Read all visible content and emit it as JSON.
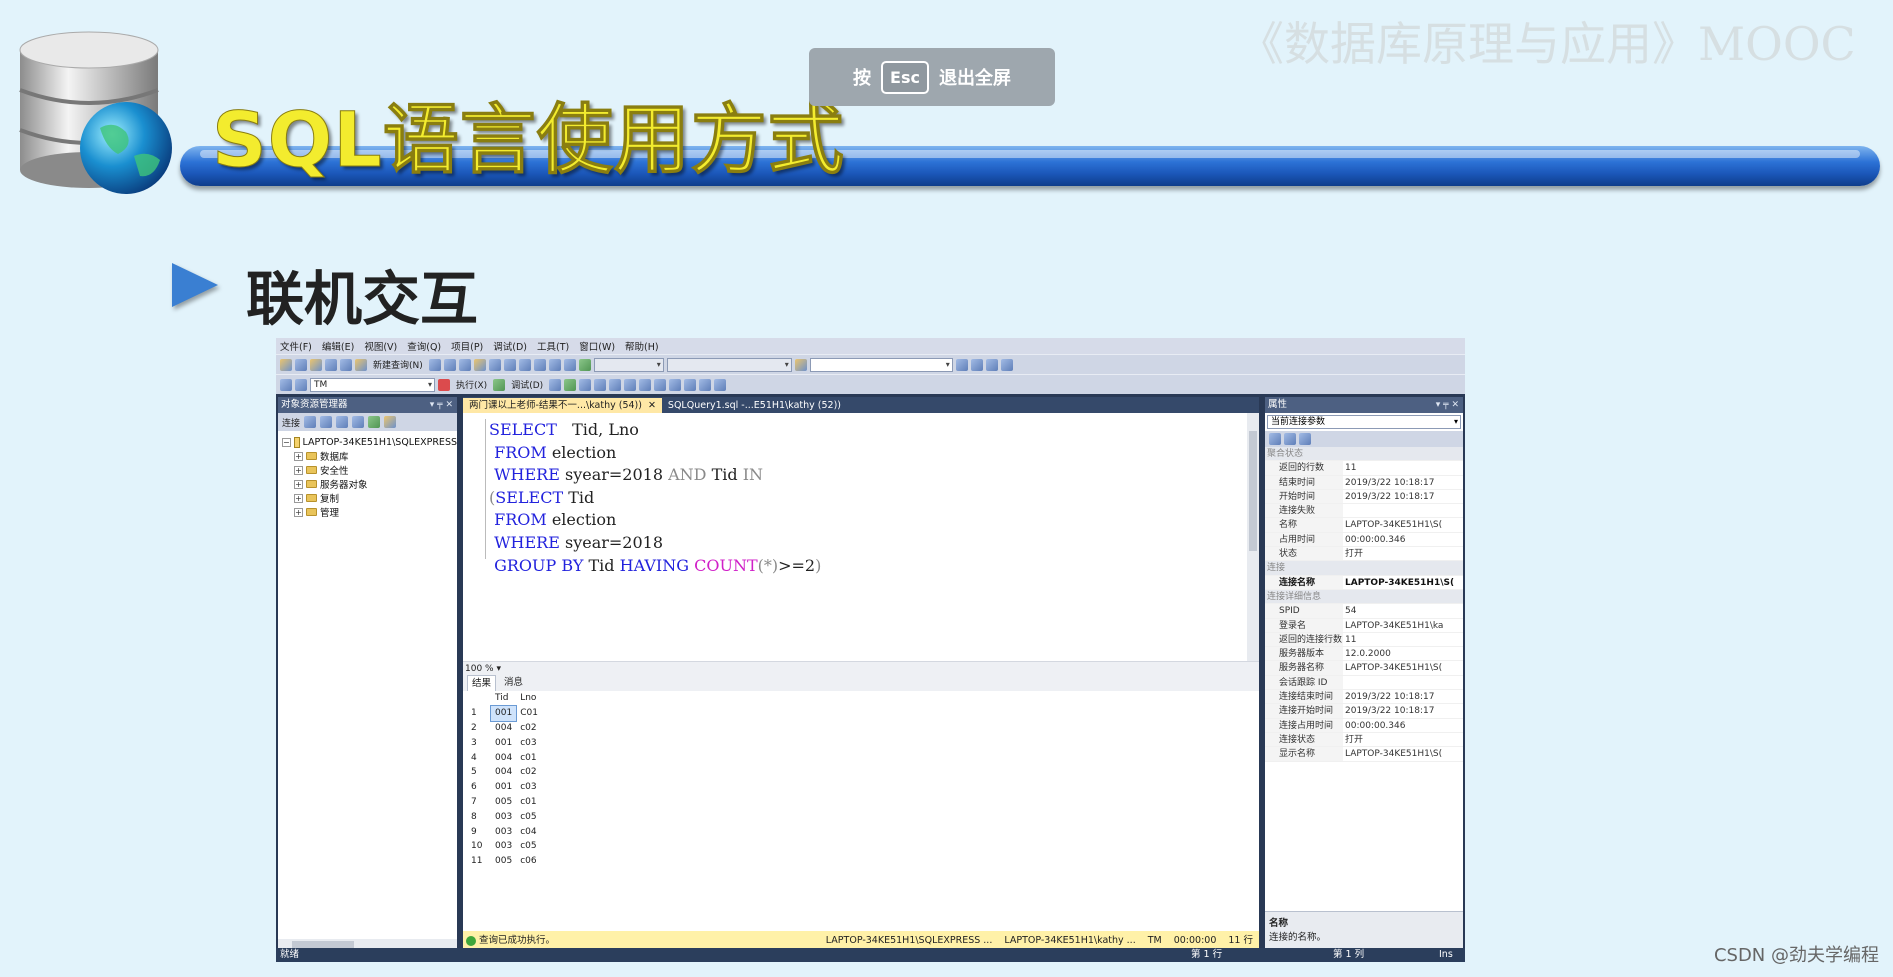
{
  "slide": {
    "title": "SQL语言使用方式",
    "course": "《数据库原理与应用》MOOC",
    "bullet": "联机交互",
    "watermark": "CSDN @劲夫学编程"
  },
  "overlay": {
    "prefix": "按",
    "key": "Esc",
    "suffix": "退出全屏"
  },
  "ssms": {
    "menu": [
      "文件(F)",
      "编辑(E)",
      "视图(V)",
      "查询(Q)",
      "项目(P)",
      "调试(D)",
      "工具(T)",
      "窗口(W)",
      "帮助(H)"
    ],
    "toolbar": {
      "new_query": "新建查询(N)",
      "database_combo": "TM",
      "execute": "执行(X)",
      "debug": "调试(D)"
    },
    "object_explorer": {
      "title": "对象资源管理器",
      "connect": "连接",
      "server": "LAPTOP-34KE51H1\\SQLEXPRESS",
      "nodes": [
        "数据库",
        "安全性",
        "服务器对象",
        "复制",
        "管理"
      ]
    },
    "tabs": [
      {
        "label": "两门课以上老师-结果不一...\\kathy (54))",
        "active": true
      },
      {
        "label": "SQLQuery1.sql -...E51H1\\kathy (52))",
        "active": false
      }
    ],
    "zoom": "100 %",
    "result_tabs": {
      "results": "结果",
      "messages": "消息"
    },
    "results": {
      "columns": [
        "Tid",
        "Lno"
      ],
      "rows": [
        [
          "1",
          "001",
          "C01"
        ],
        [
          "2",
          "004",
          "c02"
        ],
        [
          "3",
          "001",
          "c03"
        ],
        [
          "4",
          "004",
          "c01"
        ],
        [
          "5",
          "004",
          "c02"
        ],
        [
          "6",
          "001",
          "c03"
        ],
        [
          "7",
          "005",
          "c01"
        ],
        [
          "8",
          "003",
          "c05"
        ],
        [
          "9",
          "003",
          "c04"
        ],
        [
          "10",
          "003",
          "c05"
        ],
        [
          "11",
          "005",
          "c06"
        ]
      ]
    },
    "status": {
      "message": "查询已成功执行。",
      "server": "LAPTOP-34KE51H1\\SQLEXPRESS ...",
      "user": "LAPTOP-34KE51H1\\kathy ...",
      "db": "TM",
      "time": "00:00:00",
      "rows": "11 行"
    },
    "properties": {
      "title": "属性",
      "combo": "当前连接参数",
      "categories": {
        "aggregate": "聚合状态",
        "connection": "连接",
        "details": "连接详细信息"
      },
      "aggregate_rows": [
        [
          "返回的行数",
          "11"
        ],
        [
          "结束时间",
          "2019/3/22 10:18:17"
        ],
        [
          "开始时间",
          "2019/3/22 10:18:17"
        ],
        [
          "连接失败",
          ""
        ],
        [
          "名称",
          "LAPTOP-34KE51H1\\S("
        ],
        [
          "占用时间",
          "00:00:00.346"
        ],
        [
          "状态",
          "打开"
        ]
      ],
      "connection_rows": [
        [
          "连接名称",
          "LAPTOP-34KE51H1\\S("
        ]
      ],
      "detail_rows": [
        [
          "SPID",
          "54"
        ],
        [
          "登录名",
          "LAPTOP-34KE51H1\\ka"
        ],
        [
          "返回的连接行数",
          "11"
        ],
        [
          "服务器版本",
          "12.0.2000"
        ],
        [
          "服务器名称",
          "LAPTOP-34KE51H1\\S("
        ],
        [
          "会话跟踪 ID",
          ""
        ],
        [
          "连接结束时间",
          "2019/3/22 10:18:17"
        ],
        [
          "连接开始时间",
          "2019/3/22 10:18:17"
        ],
        [
          "连接占用时间",
          "00:00:00.346"
        ],
        [
          "连接状态",
          "打开"
        ],
        [
          "显示名称",
          "LAPTOP-34KE51H1\\S("
        ]
      ],
      "desc_title": "名称",
      "desc_text": "连接的名称。"
    },
    "bottom": {
      "ready": "就绪",
      "line": "第 1 行",
      "col": "第 1 列",
      "ins": "Ins"
    }
  }
}
